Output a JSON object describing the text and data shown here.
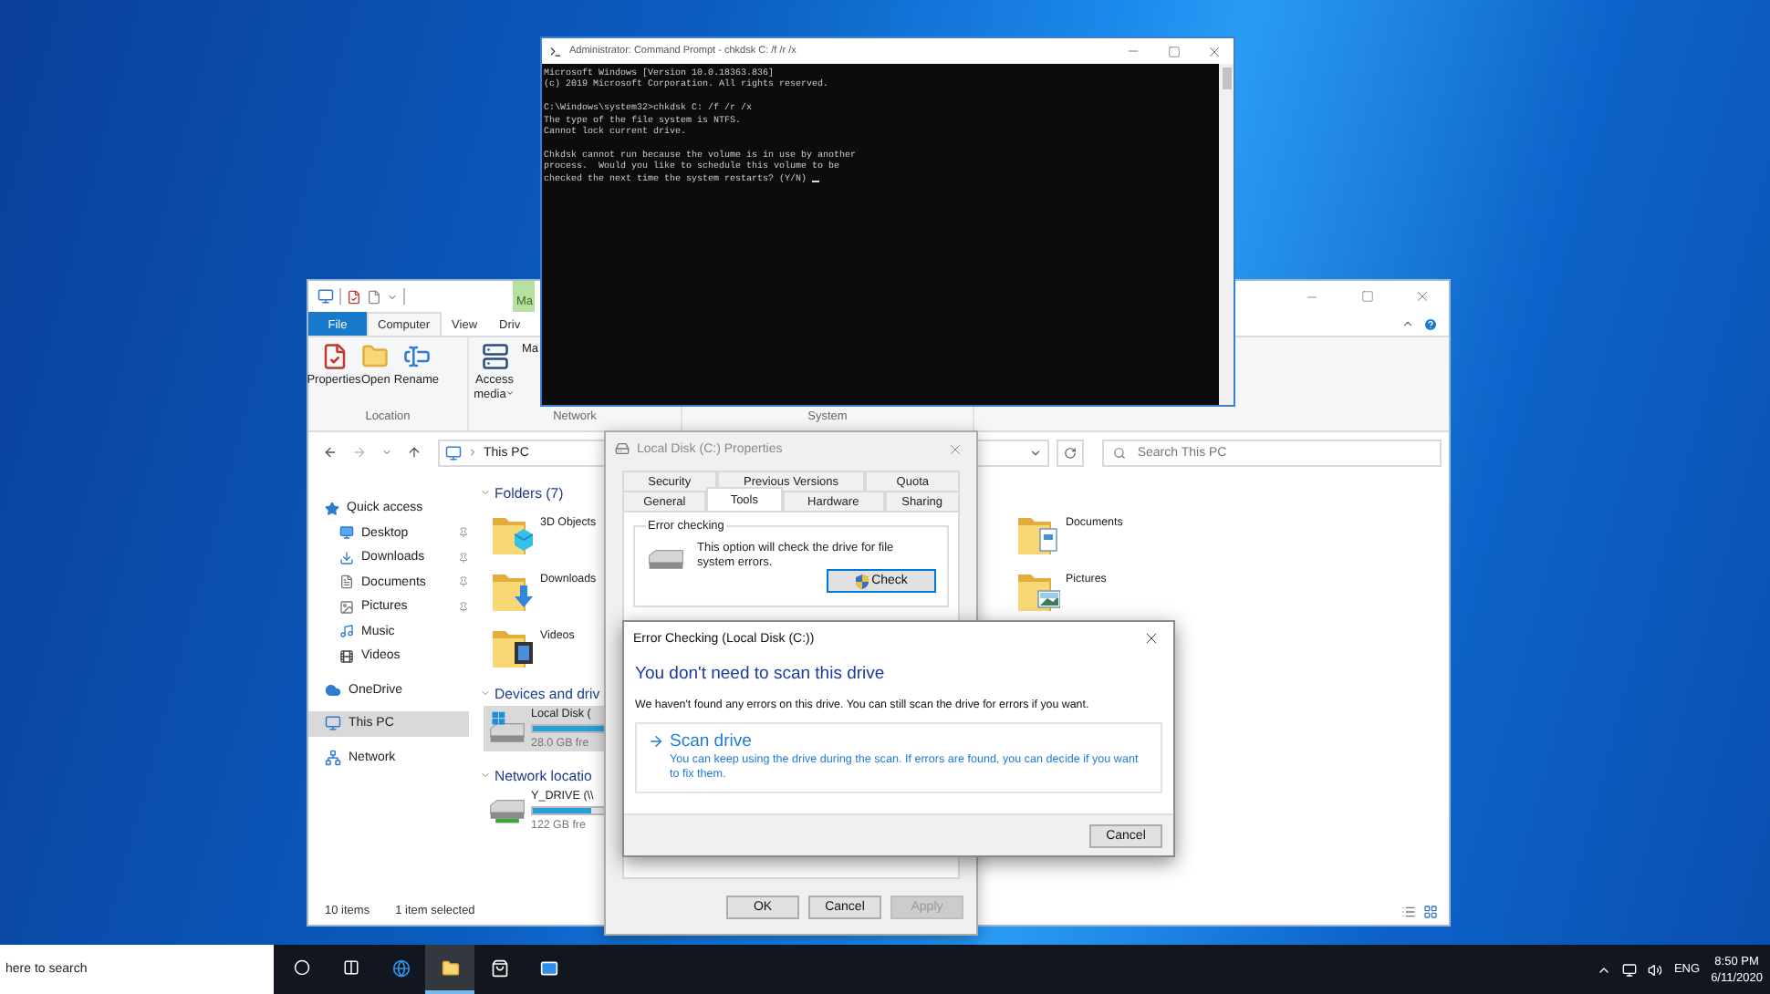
{
  "command_prompt": {
    "title": "Administrator: Command Prompt - chkdsk  C: /f /r /x",
    "blocks": [
      [
        "Microsoft Windows [Version 10.0.18363.836]",
        "(c) 2019 Microsoft Corporation. All rights reserved."
      ],
      [
        "C:\\Windows\\system32>chkdsk C: /f /r /x",
        "The type of the file system is NTFS.",
        "Cannot lock current drive."
      ],
      [
        "Chkdsk cannot run because the volume is in use by another",
        "process.  Would you like to schedule this volume to be",
        "checked the next time the system restarts? (Y/N)"
      ]
    ]
  },
  "explorer": {
    "context_tab": "Ma",
    "ribbon_tabs": [
      {
        "label": "File",
        "kind": "file",
        "selected": false
      },
      {
        "label": "Computer",
        "kind": "tab",
        "selected": true
      },
      {
        "label": "View",
        "kind": "tab",
        "selected": false
      },
      {
        "label": "Driv",
        "kind": "tab",
        "selected": false
      }
    ],
    "ribbon_groups": [
      {
        "label": "Location",
        "buttons": [
          {
            "label": "Properties",
            "dropdown": false
          },
          {
            "label": "Open",
            "dropdown": false
          },
          {
            "label": "Rename",
            "dropdown": false
          }
        ]
      },
      {
        "label": "Network",
        "buttons": [
          {
            "label": "Access media",
            "dropdown": true
          },
          {
            "label": "Ma",
            "dropdown": false
          }
        ]
      },
      {
        "label": "System"
      }
    ],
    "address": {
      "location": "This PC"
    },
    "search": {
      "placeholder": "Search This PC"
    },
    "sidebar": [
      {
        "label": "Quick access",
        "selected": false,
        "children": [
          {
            "label": "Desktop",
            "pinned": true,
            "selected": false
          },
          {
            "label": "Downloads",
            "pinned": true,
            "selected": false
          },
          {
            "label": "Documents",
            "pinned": true,
            "selected": false
          },
          {
            "label": "Pictures",
            "pinned": true,
            "selected": false
          },
          {
            "label": "Music",
            "pinned": false,
            "selected": false
          },
          {
            "label": "Videos",
            "pinned": false,
            "selected": false
          }
        ]
      },
      {
        "label": "OneDrive",
        "selected": false
      },
      {
        "label": "This PC",
        "selected": true
      },
      {
        "label": "Network",
        "selected": false
      }
    ],
    "folders": {
      "title": "Folders (7)",
      "items": [
        {
          "label": "3D Objects"
        },
        {
          "label": "Documents"
        },
        {
          "label": "Downloads"
        },
        {
          "label": "Pictures"
        },
        {
          "label": "Videos"
        }
      ]
    },
    "drive_sections": [
      {
        "title": "Devices and driv",
        "items": [
          {
            "label": "Local Disk (",
            "free": "28.0 GB fre",
            "level": 0.75,
            "selected": true
          }
        ]
      },
      {
        "title": "Network locatio",
        "items": [
          {
            "label": "Y_DRIVE (\\\\",
            "free": "122 GB fre",
            "level": 0.55,
            "selected": false
          }
        ]
      }
    ],
    "status": [
      "10 items",
      "1 item selected"
    ]
  },
  "properties_dialog": {
    "title": "Local Disk (C:) Properties",
    "tab_rows": [
      [
        {
          "label": "Security",
          "selected": false
        },
        {
          "label": "Previous Versions",
          "selected": false
        },
        {
          "label": "Quota",
          "selected": false
        }
      ],
      [
        {
          "label": "General",
          "selected": false
        },
        {
          "label": "Tools",
          "selected": true
        },
        {
          "label": "Hardware",
          "selected": false
        },
        {
          "label": "Sharing",
          "selected": false
        }
      ]
    ],
    "group": "Error checking",
    "text": "This option will check the drive for file system errors.",
    "check_button": "Check",
    "buttons": [
      {
        "label": "OK",
        "disabled": false
      },
      {
        "label": "Cancel",
        "disabled": false
      },
      {
        "label": "Apply",
        "disabled": true
      }
    ]
  },
  "error_dialog": {
    "title": "Error Checking (Local Disk (C:))",
    "heading": "You don't need to scan this drive",
    "message": "We haven't found any errors on this drive. You can still scan the drive for errors if you want.",
    "option": {
      "title": "Scan drive",
      "description": "You can keep using the drive during the scan. If errors are found, you can decide if you want to fix them."
    },
    "button": "Cancel"
  },
  "taskbar": {
    "search": "here to search",
    "apps": [
      {
        "active": false
      },
      {
        "active": false
      },
      {
        "active": false
      },
      {
        "active": true
      },
      {
        "active": false
      },
      {
        "active": false
      }
    ],
    "language": "ENG",
    "time": "8:50 PM",
    "date": "6/11/2020"
  }
}
